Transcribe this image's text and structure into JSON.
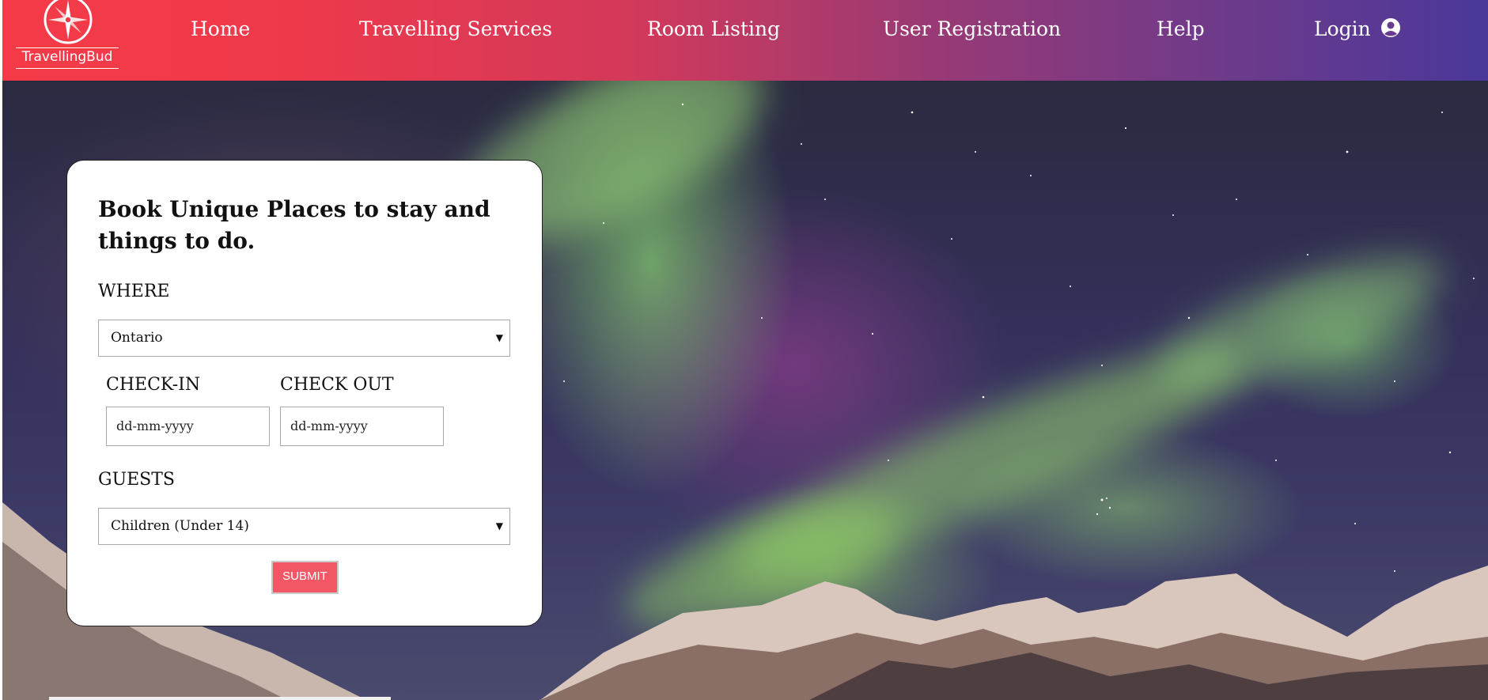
{
  "brand": {
    "name": "TravellingBud"
  },
  "nav": {
    "items": [
      {
        "label": "Home"
      },
      {
        "label": "Travelling Services"
      },
      {
        "label": "Room Listing"
      },
      {
        "label": "User Registration"
      },
      {
        "label": "Help"
      },
      {
        "label": "Login"
      }
    ]
  },
  "booking": {
    "title": "Book Unique Places to stay and things to do.",
    "where_label": "WHERE",
    "where_value": "Ontario",
    "checkin_label": "CHECK-IN",
    "checkin_placeholder": "dd-mm-yyyy",
    "checkout_label": "CHECK OUT",
    "checkout_placeholder": "dd-mm-yyyy",
    "guests_label": "GUESTS",
    "guests_value": "Children (Under 14)",
    "submit_label": "SUBMIT"
  },
  "colors": {
    "header_gradient_start": "#f43a47",
    "header_gradient_end": "#4a389a",
    "submit_button": "#f25766"
  },
  "icons": [
    "compass-icon",
    "user-circle-icon",
    "dropdown-arrow-icon"
  ]
}
